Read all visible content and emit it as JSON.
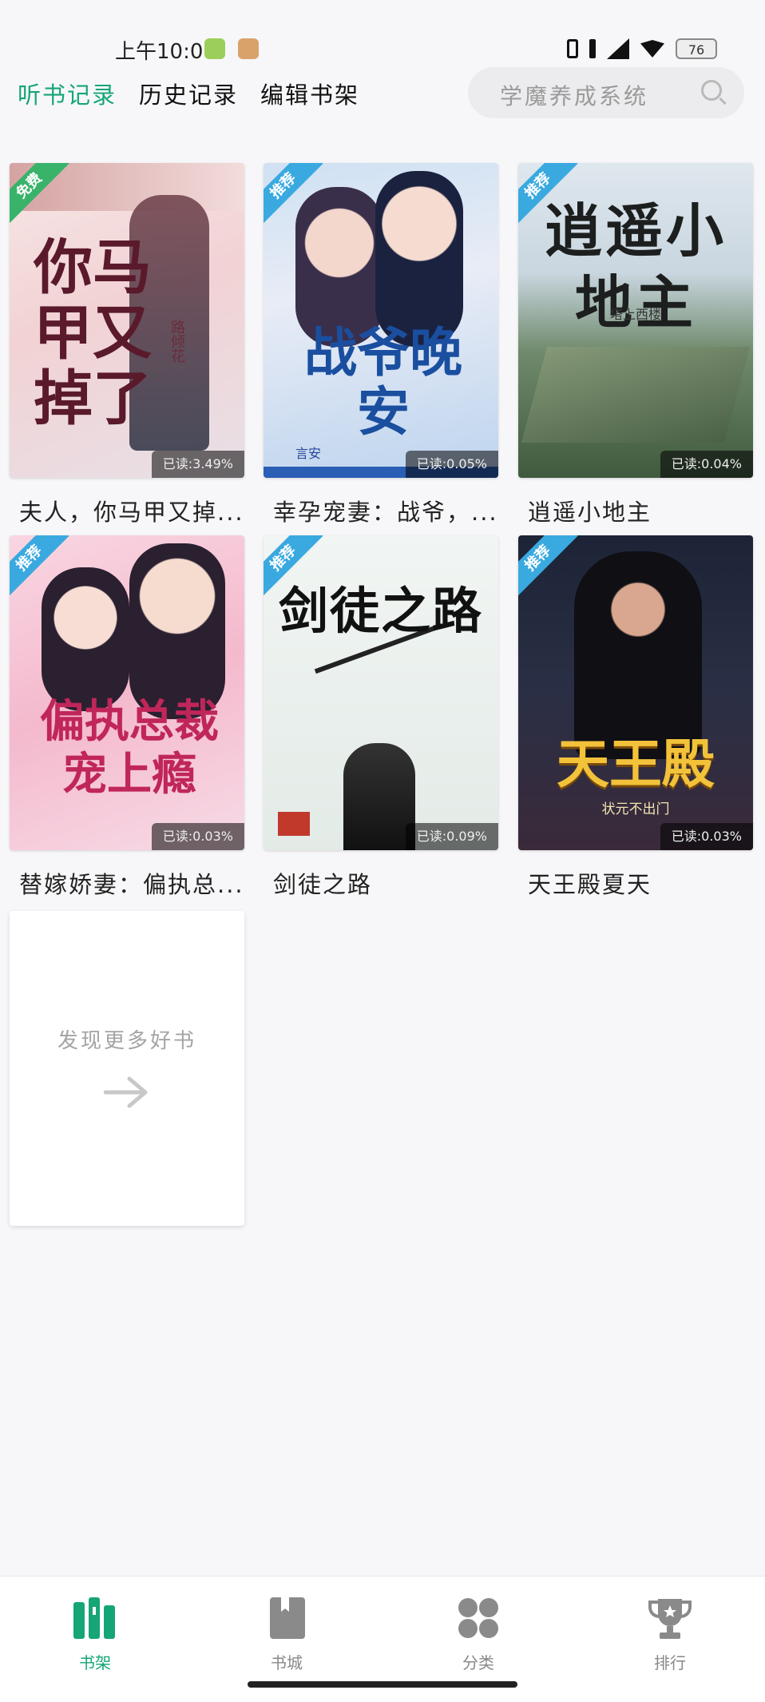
{
  "status_bar": {
    "time": "上午10:00",
    "battery": "76"
  },
  "header": {
    "tabs": [
      {
        "label": "听书记录",
        "active": true
      },
      {
        "label": "历史记录",
        "active": false
      },
      {
        "label": "编辑书架",
        "active": false
      }
    ],
    "search": {
      "placeholder": "学魔养成系统"
    }
  },
  "books": [
    {
      "title": "夫人，你马甲又掉...",
      "badge": "免费",
      "progress": "已读:3.49%",
      "cover_text": "你马甲又掉了",
      "cover_author": "路倾花"
    },
    {
      "title": "幸孕宠妻：战爷，...",
      "badge": "推荐",
      "progress": "已读:0.05%",
      "cover_text": "战爷晚安",
      "cover_author": "言安"
    },
    {
      "title": "逍遥小地主",
      "badge": "推荐",
      "progress": "已读:0.04%",
      "cover_text": "逍遥小地主",
      "cover_author": "塔上西楼"
    },
    {
      "title": "替嫁娇妻：偏执总...",
      "badge": "推荐",
      "progress": "已读:0.03%",
      "cover_text": "偏执总裁宠上瘾",
      "cover_author": ""
    },
    {
      "title": "剑徒之路",
      "badge": "推荐",
      "progress": "已读:0.09%",
      "cover_text": "剑徒之路",
      "cover_author": ""
    },
    {
      "title": "天王殿夏天",
      "badge": "推荐",
      "progress": "已读:0.03%",
      "cover_text": "天王殿",
      "cover_author": "状元不出门"
    }
  ],
  "discover": {
    "label": "发现更多好书"
  },
  "bottom_nav": [
    {
      "label": "书架",
      "active": true
    },
    {
      "label": "书城",
      "active": false
    },
    {
      "label": "分类",
      "active": false
    },
    {
      "label": "排行",
      "active": false
    }
  ],
  "colors": {
    "accent": "#16a577",
    "badge_recommend": "#3aa9e0",
    "badge_free": "#39b36a"
  }
}
